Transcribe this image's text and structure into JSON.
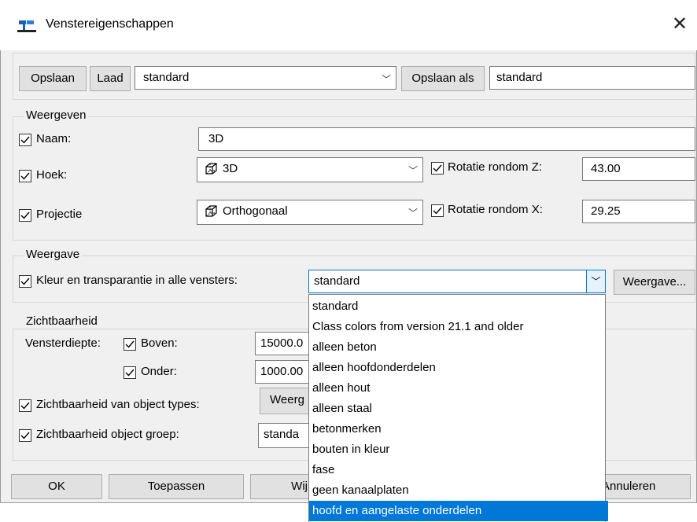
{
  "window": {
    "title": "Venstereigenschappen",
    "close_label": "✕"
  },
  "toolbar": {
    "save_label": "Opslaan",
    "load_label": "Laad",
    "preset_value": "standard",
    "save_as_label": "Opslaan als",
    "save_as_value": "standard"
  },
  "weergeven": {
    "legend": "Weergeven",
    "naam_label": "Naam:",
    "naam_value": "3D",
    "hoek_label": "Hoek:",
    "hoek_value": "3D",
    "rot_z_label": "Rotatie rondom Z:",
    "rot_z_value": "43.00",
    "projectie_label": "Projectie",
    "projectie_value": "Orthogonaal",
    "rot_x_label": "Rotatie rondom X:",
    "rot_x_value": "29.25"
  },
  "weergave": {
    "legend": "Weergave",
    "kleur_label": "Kleur en transparantie in alle vensters:",
    "kleur_value": "standard",
    "button_label": "Weergave..."
  },
  "zichtbaarheid": {
    "legend": "Zichtbaarheid",
    "diepte_label": "Vensterdiepte:",
    "boven_label": "Boven:",
    "boven_value": "15000.0",
    "onder_label": "Onder:",
    "onder_value": "1000.00",
    "object_types_label": "Zichtbaarheid van object types:",
    "object_types_button": "Weerg",
    "object_groep_label": "Zichtbaarheid object groep:",
    "object_groep_value": "standa"
  },
  "dropdown": {
    "items": [
      "standard",
      "Class colors from version 21.1 and older",
      "alleen beton",
      "alleen hoofdonderdelen",
      "alleen hout",
      "alleen staal",
      "betonmerken",
      "bouten in kleur",
      "fase",
      "geen kanaalplaten",
      "hoofd en aangelaste onderdelen"
    ],
    "selected_index": 10
  },
  "footer": {
    "ok_label": "OK",
    "apply_label": "Toepassen",
    "modify_label": "Wij",
    "cancel_label": "Annuleren"
  },
  "colors": {
    "accent": "#0078d7",
    "dialog_bg": "#f0f0f0",
    "button_bg": "#e1e1e1"
  }
}
